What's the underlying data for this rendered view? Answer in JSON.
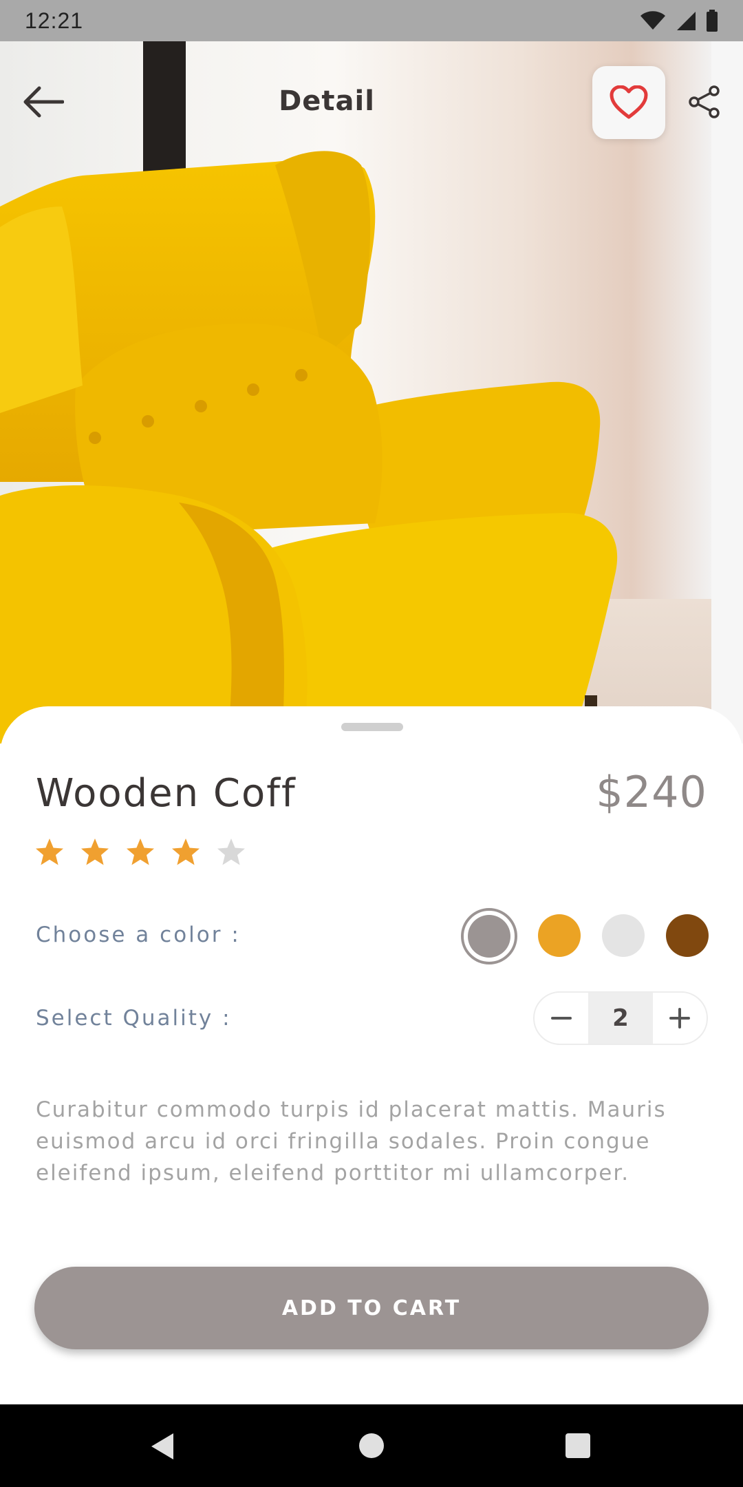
{
  "status_bar": {
    "time": "12:21"
  },
  "header": {
    "title": "Detail"
  },
  "product": {
    "name": "Wooden Coff",
    "price": "$240",
    "rating": 4,
    "rating_max": 5,
    "color_label": "Choose a color :",
    "colors": [
      "#9b9493",
      "#eba324",
      "#e4e4e4",
      "#80480f"
    ],
    "selected_color_index": 0,
    "quality_label": "Select Quality :",
    "quantity": "2",
    "description": "Curabitur commodo turpis id placerat mattis. Mauris euismod arcu id orci fringilla sodales. Proin congue eleifend ipsum, eleifend porttitor mi ullamcorper."
  },
  "actions": {
    "add_to_cart": "ADD TO CART"
  },
  "theme": {
    "accent": "#9c9493",
    "favorite": "#e23b3b",
    "star": "#f0a030",
    "star_empty": "#d8d8d8"
  },
  "icons": [
    "back-arrow-icon",
    "heart-icon",
    "share-icon",
    "star-icon",
    "minus-icon",
    "plus-icon"
  ]
}
